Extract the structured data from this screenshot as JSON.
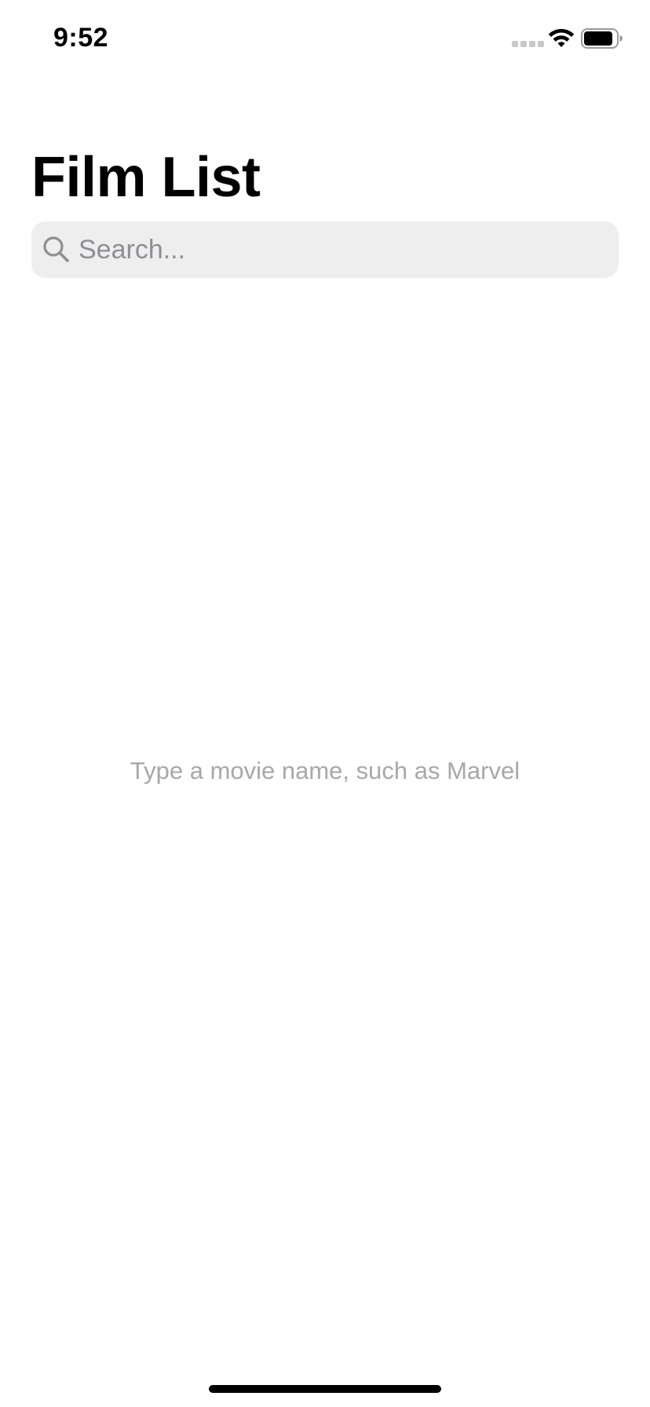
{
  "status_bar": {
    "time": "9:52"
  },
  "header": {
    "title": "Film List"
  },
  "search": {
    "placeholder": "Search...",
    "value": ""
  },
  "empty_state": {
    "message": "Type a movie name, such as Marvel"
  },
  "icons": {
    "search": "search-icon",
    "wifi": "wifi-icon",
    "battery": "battery-icon",
    "signal": "cellular-signal-icon"
  },
  "colors": {
    "background": "#ffffff",
    "search_field_bg": "#eeeeee",
    "placeholder": "#8e8e93",
    "hint_text": "#a8a8ac",
    "title": "#000000"
  }
}
